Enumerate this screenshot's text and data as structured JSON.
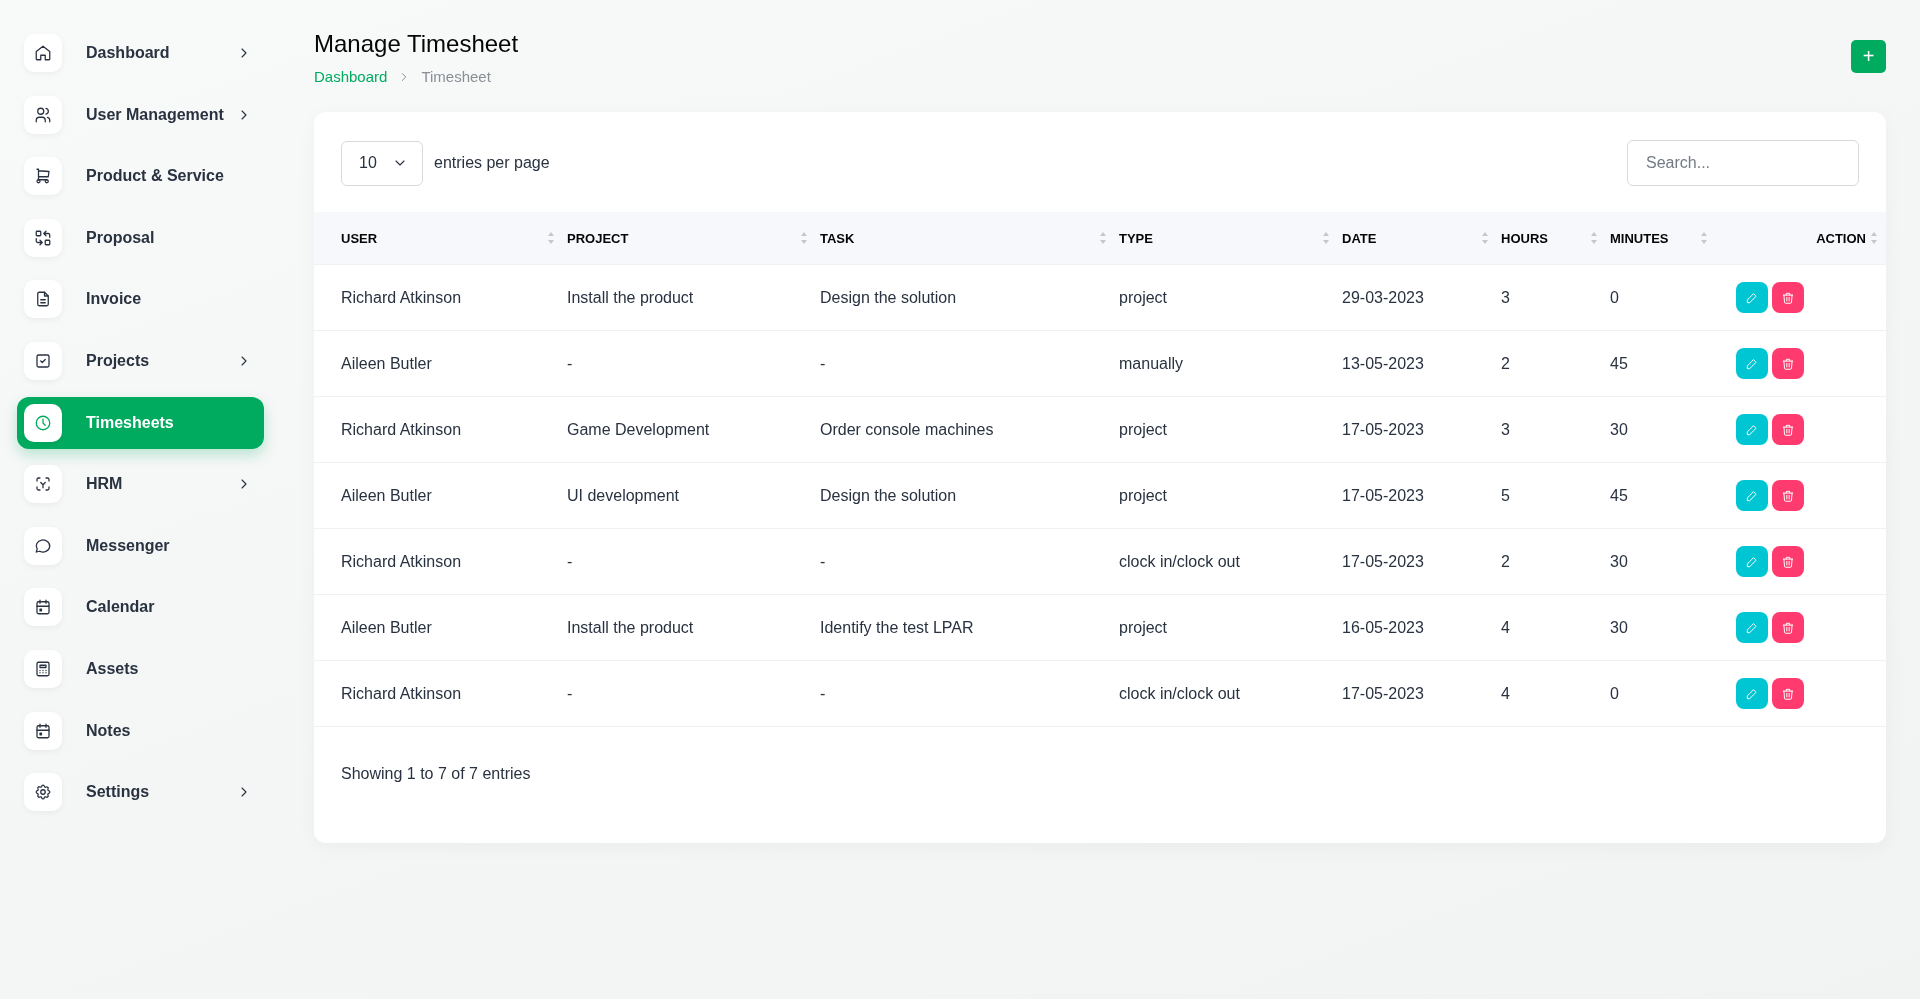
{
  "sidebar": {
    "items": [
      {
        "label": "Dashboard",
        "has_submenu": true,
        "selected": false
      },
      {
        "label": "User Management",
        "has_submenu": true,
        "selected": false
      },
      {
        "label": "Product & Service",
        "has_submenu": false,
        "selected": false
      },
      {
        "label": "Proposal",
        "has_submenu": false,
        "selected": false
      },
      {
        "label": "Invoice",
        "has_submenu": false,
        "selected": false
      },
      {
        "label": "Projects",
        "has_submenu": true,
        "selected": false
      },
      {
        "label": "Timesheets",
        "has_submenu": false,
        "selected": true
      },
      {
        "label": "HRM",
        "has_submenu": true,
        "selected": false
      },
      {
        "label": "Messenger",
        "has_submenu": false,
        "selected": false
      },
      {
        "label": "Calendar",
        "has_submenu": false,
        "selected": false
      },
      {
        "label": "Assets",
        "has_submenu": false,
        "selected": false
      },
      {
        "label": "Notes",
        "has_submenu": false,
        "selected": false
      },
      {
        "label": "Settings",
        "has_submenu": true,
        "selected": false
      }
    ]
  },
  "header": {
    "title": "Manage Timesheet",
    "breadcrumb": [
      "Dashboard",
      "Timesheet"
    ],
    "add_button": "+"
  },
  "table_controls": {
    "page_size": "10",
    "page_size_label": "entries per page",
    "search": {
      "placeholder": "Search..."
    }
  },
  "table": {
    "columns": [
      "USER",
      "PROJECT",
      "TASK",
      "TYPE",
      "DATE",
      "HOURS",
      "MINUTES",
      "ACTION"
    ],
    "rows": [
      [
        "Richard Atkinson",
        "Install the product",
        "Design the solution",
        "project",
        "29-03-2023",
        "3",
        "0"
      ],
      [
        "Aileen Butler",
        "-",
        "-",
        "manually",
        "13-05-2023",
        "2",
        "45"
      ],
      [
        "Richard Atkinson",
        "Game Development",
        "Order console machines",
        "project",
        "17-05-2023",
        "3",
        "30"
      ],
      [
        "Aileen Butler",
        "UI development",
        "Design the solution",
        "project",
        "17-05-2023",
        "5",
        "45"
      ],
      [
        "Richard Atkinson",
        "-",
        "-",
        "clock in/clock out",
        "17-05-2023",
        "2",
        "30"
      ],
      [
        "Aileen Butler",
        "Install the product",
        "Identify the test LPAR",
        "project",
        "16-05-2023",
        "4",
        "30"
      ],
      [
        "Richard Atkinson",
        "-",
        "-",
        "clock in/clock out",
        "17-05-2023",
        "4",
        "0"
      ]
    ]
  },
  "footer": {
    "summary": "Showing 1 to 7 of 7 entries"
  }
}
